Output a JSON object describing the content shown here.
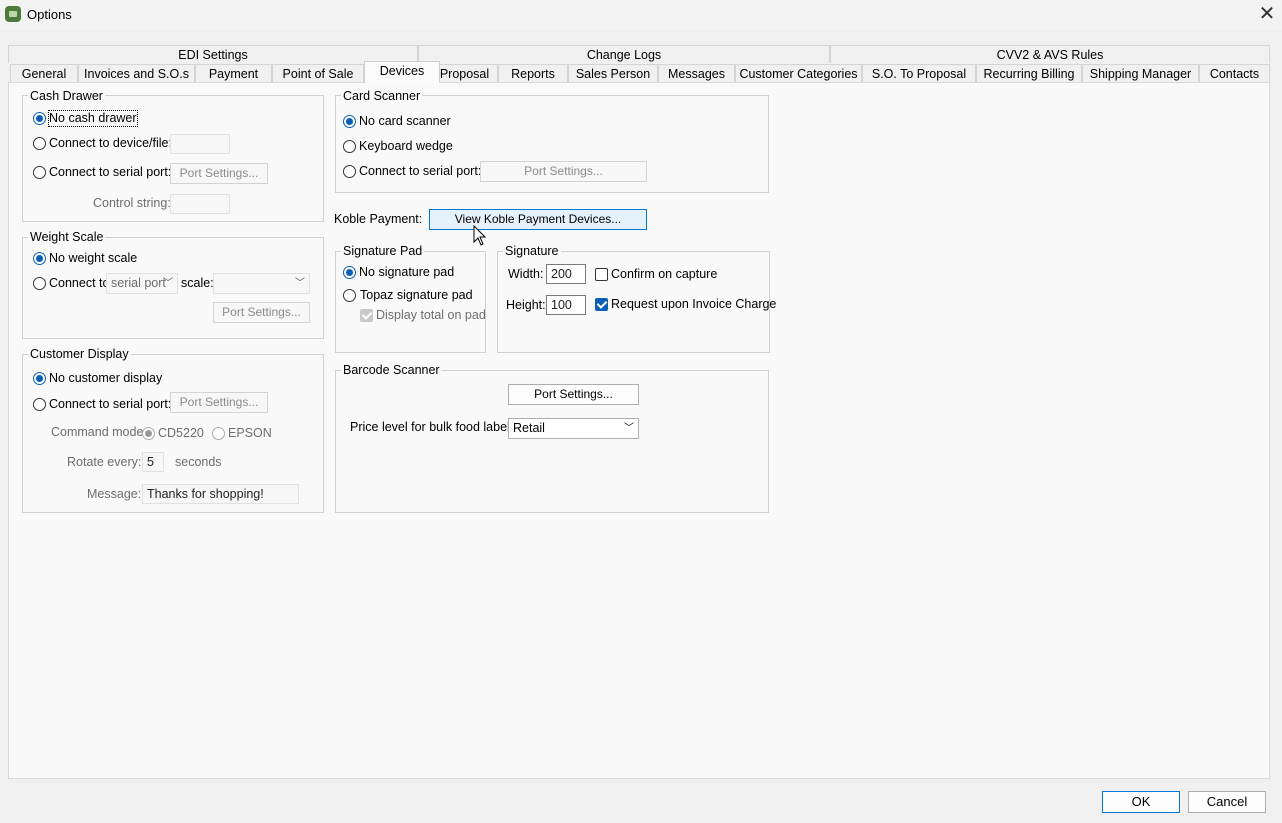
{
  "window": {
    "title": "Options"
  },
  "tabs": {
    "row1": [
      "EDI Settings",
      "Change Logs",
      "CVV2 & AVS Rules"
    ],
    "row2": [
      "General",
      "Invoices and S.O.s",
      "Payment",
      "Point of Sale",
      "Devices",
      "Proposal",
      "Reports",
      "Sales Person",
      "Messages",
      "Customer Categories",
      "S.O. To Proposal",
      "Recurring Billing",
      "Shipping Manager",
      "Contacts"
    ],
    "selected": "Devices"
  },
  "cash_drawer": {
    "legend": "Cash Drawer",
    "opt_none": "No cash drawer",
    "opt_device": "Connect to device/file:",
    "opt_serial": "Connect to serial port:",
    "port_settings": "Port Settings...",
    "control_string_label": "Control string:"
  },
  "weight_scale": {
    "legend": "Weight Scale",
    "opt_none": "No weight scale",
    "opt_connect": "Connect to",
    "port_select": "serial port",
    "scale_label": "scale:",
    "port_settings": "Port Settings..."
  },
  "customer_display": {
    "legend": "Customer Display",
    "opt_none": "No customer display",
    "opt_serial": "Connect to serial port:",
    "port_settings": "Port Settings...",
    "command_mode_label": "Command mode:",
    "mode_cd5220": "CD5220",
    "mode_epson": "EPSON",
    "rotate_label": "Rotate every:",
    "rotate_value": "5",
    "rotate_unit": "seconds",
    "message_label": "Message:",
    "message_value": "Thanks for shopping!"
  },
  "card_scanner": {
    "legend": "Card Scanner",
    "opt_none": "No card scanner",
    "opt_wedge": "Keyboard wedge",
    "opt_serial": "Connect to serial port:",
    "port_settings": "Port Settings..."
  },
  "koble": {
    "label": "Koble Payment:",
    "button": "View Koble Payment Devices..."
  },
  "signature_pad": {
    "legend": "Signature Pad",
    "opt_none": "No signature pad",
    "opt_topaz": "Topaz signature pad",
    "display_total": "Display total on pad"
  },
  "signature": {
    "legend": "Signature",
    "width_label": "Width:",
    "width_value": "200",
    "height_label": "Height:",
    "height_value": "100",
    "confirm_capture": "Confirm on capture",
    "request_invoice": "Request upon Invoice Charge"
  },
  "barcode": {
    "legend": "Barcode Scanner",
    "port_settings": "Port Settings...",
    "price_level_label": "Price level for bulk food label:",
    "price_level_value": "Retail"
  },
  "footer": {
    "ok": "OK",
    "cancel": "Cancel"
  }
}
